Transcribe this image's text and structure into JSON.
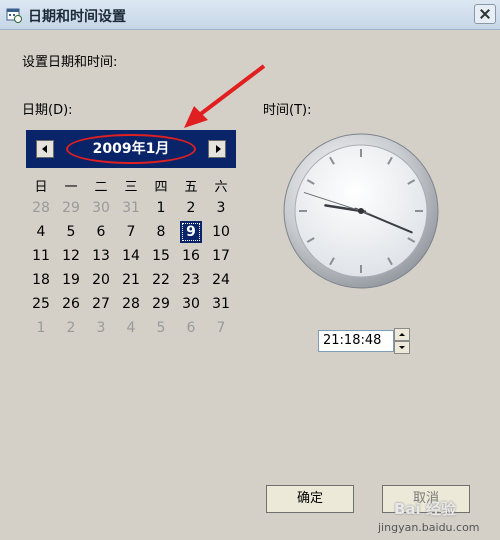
{
  "window": {
    "title": "日期和时间设置"
  },
  "labels": {
    "instruction": "设置日期和时间:",
    "date": "日期(D):",
    "time": "时间(T):"
  },
  "calendar": {
    "month_title": "2009年1月",
    "weekdays": [
      "日",
      "一",
      "二",
      "三",
      "四",
      "五",
      "六"
    ],
    "weeks": [
      [
        "28",
        "29",
        "30",
        "31",
        "1",
        "2",
        "3"
      ],
      [
        "4",
        "5",
        "6",
        "7",
        "8",
        "9",
        "10"
      ],
      [
        "11",
        "12",
        "13",
        "14",
        "15",
        "16",
        "17"
      ],
      [
        "18",
        "19",
        "20",
        "21",
        "22",
        "23",
        "24"
      ],
      [
        "25",
        "26",
        "27",
        "28",
        "29",
        "30",
        "31"
      ],
      [
        "1",
        "2",
        "3",
        "4",
        "5",
        "6",
        "7"
      ]
    ],
    "selected": "9"
  },
  "time": {
    "value": "21:18:48"
  },
  "buttons": {
    "ok": "确定",
    "cancel": "取消"
  },
  "watermark": {
    "text": "Bai 经验",
    "url": "jingyan.baidu.com"
  },
  "colors": {
    "selection": "#0a246a",
    "annotation": "#e02020",
    "window": "#d4d0c8"
  },
  "icons": {
    "title": "calendar-clock-icon",
    "prev": "arrow-left-icon",
    "next": "arrow-right-icon"
  }
}
